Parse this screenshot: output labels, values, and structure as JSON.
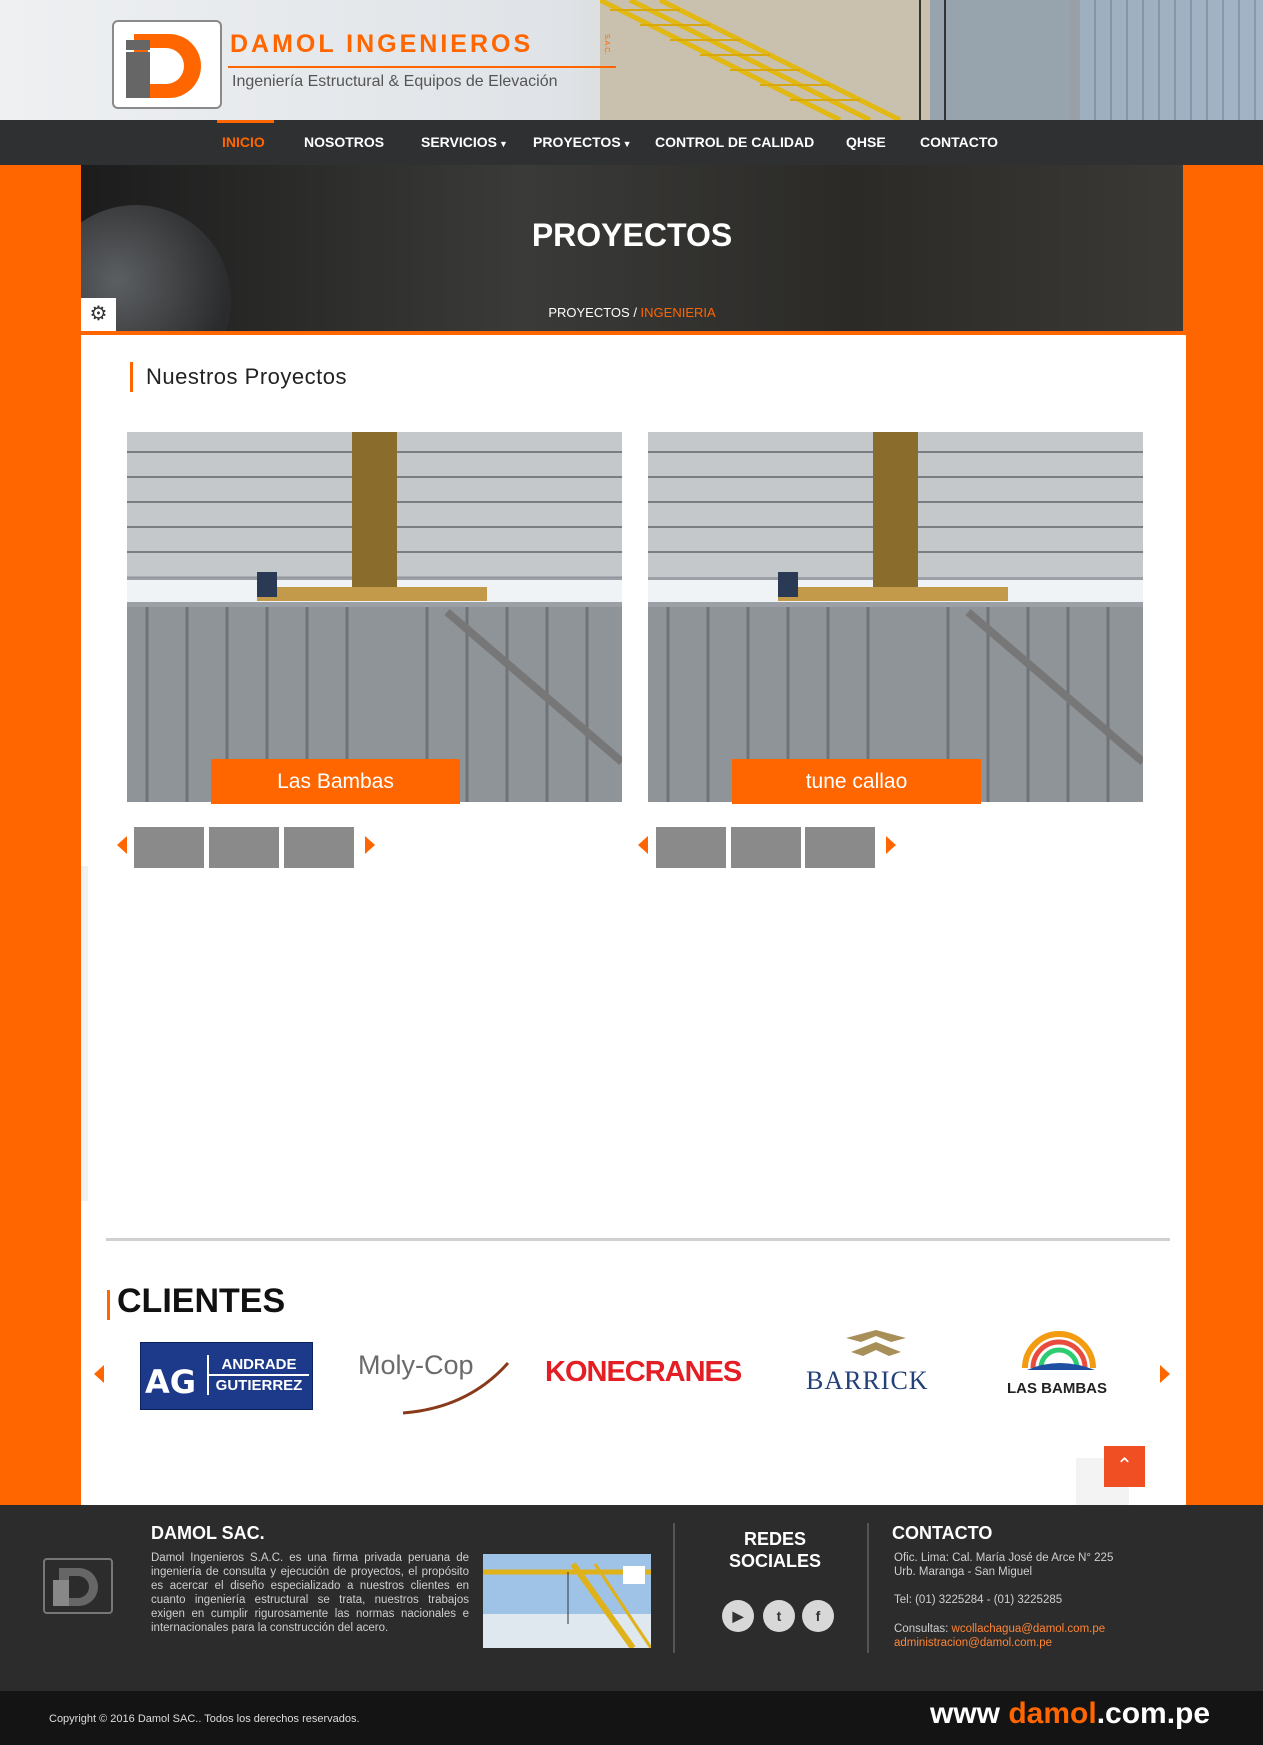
{
  "brand": {
    "name": "DAMOL INGENIEROS",
    "suffix": "S.A.C.",
    "tagline": "Ingeniería Estructural & Equipos de Elevación"
  },
  "nav": {
    "items": [
      {
        "label": "INICIO",
        "active": true
      },
      {
        "label": "NOSOTROS"
      },
      {
        "label": "SERVICIOS",
        "dropdown": true
      },
      {
        "label": "PROYECTOS",
        "dropdown": true
      },
      {
        "label": "CONTROL DE CALIDAD"
      },
      {
        "label": "QHSE"
      },
      {
        "label": "CONTACTO"
      }
    ]
  },
  "banner": {
    "title": "PROYECTOS",
    "breadcrumb": {
      "parent": "PROYECTOS",
      "separator": " / ",
      "current": "INGENIERIA"
    }
  },
  "section": {
    "title": "Nuestros Proyectos"
  },
  "projects": [
    {
      "caption": "Las Bambas"
    },
    {
      "caption": "tune callao"
    }
  ],
  "clients": {
    "title": "CLIENTES",
    "logos": [
      {
        "line1": "ANDRADE",
        "line2": "GUTIERREZ",
        "mark": "AG"
      },
      {
        "text": "Moly-Cop"
      },
      {
        "text": "KONECRANES"
      },
      {
        "text": "BARRICK"
      },
      {
        "text": "LAS BAMBAS"
      }
    ]
  },
  "footer": {
    "about_title": "DAMOL SAC.",
    "about_text": "Damol Ingenieros S.A.C. es una firma privada peruana de ingeniería de consulta y ejecución de proyectos, el propósito es acercar el diseño especializado a nuestros clientes en cuanto ingeniería estructural se trata, nuestros trabajos exigen en cumplir rigurosamente las normas nacionales e internacionales para la construcción del acero.",
    "social_title_1": "REDES",
    "social_title_2": "SOCIALES",
    "social": [
      "youtube",
      "twitter",
      "facebook"
    ],
    "contact_title": "CONTACTO",
    "address_1": "Ofic. Lima: Cal. María José de Arce N° 225",
    "address_2": "Urb. Maranga - San Miguel",
    "phone": "Tel: (01) 3225284 - (01) 3225285",
    "consult_label": "Consultas:",
    "email_1": "wcollachagua@damol.com.pe",
    "email_2": "administracion@damol.com.pe"
  },
  "bottom": {
    "copyright": "Copyright © 2016 Damol SAC.. Todos los derechos reservados.",
    "site_prefix": "www ",
    "site_brand": "damol",
    "site_suffix": ".com.pe"
  },
  "colors": {
    "accent": "#ff6600",
    "nav_bg": "#2f3032",
    "footer_bg": "#2c2c2c"
  }
}
